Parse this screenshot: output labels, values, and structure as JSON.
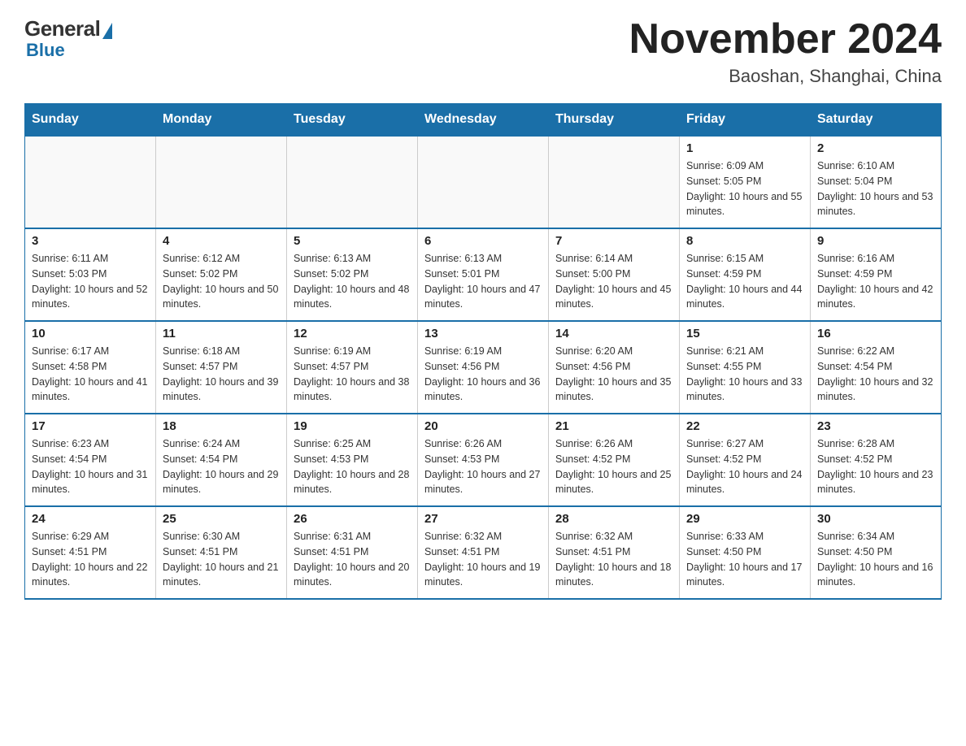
{
  "logo": {
    "general": "General",
    "blue": "Blue"
  },
  "title": {
    "month": "November 2024",
    "location": "Baoshan, Shanghai, China"
  },
  "weekdays": [
    "Sunday",
    "Monday",
    "Tuesday",
    "Wednesday",
    "Thursday",
    "Friday",
    "Saturday"
  ],
  "weeks": [
    [
      {
        "day": "",
        "info": ""
      },
      {
        "day": "",
        "info": ""
      },
      {
        "day": "",
        "info": ""
      },
      {
        "day": "",
        "info": ""
      },
      {
        "day": "",
        "info": ""
      },
      {
        "day": "1",
        "info": "Sunrise: 6:09 AM\nSunset: 5:05 PM\nDaylight: 10 hours and 55 minutes."
      },
      {
        "day": "2",
        "info": "Sunrise: 6:10 AM\nSunset: 5:04 PM\nDaylight: 10 hours and 53 minutes."
      }
    ],
    [
      {
        "day": "3",
        "info": "Sunrise: 6:11 AM\nSunset: 5:03 PM\nDaylight: 10 hours and 52 minutes."
      },
      {
        "day": "4",
        "info": "Sunrise: 6:12 AM\nSunset: 5:02 PM\nDaylight: 10 hours and 50 minutes."
      },
      {
        "day": "5",
        "info": "Sunrise: 6:13 AM\nSunset: 5:02 PM\nDaylight: 10 hours and 48 minutes."
      },
      {
        "day": "6",
        "info": "Sunrise: 6:13 AM\nSunset: 5:01 PM\nDaylight: 10 hours and 47 minutes."
      },
      {
        "day": "7",
        "info": "Sunrise: 6:14 AM\nSunset: 5:00 PM\nDaylight: 10 hours and 45 minutes."
      },
      {
        "day": "8",
        "info": "Sunrise: 6:15 AM\nSunset: 4:59 PM\nDaylight: 10 hours and 44 minutes."
      },
      {
        "day": "9",
        "info": "Sunrise: 6:16 AM\nSunset: 4:59 PM\nDaylight: 10 hours and 42 minutes."
      }
    ],
    [
      {
        "day": "10",
        "info": "Sunrise: 6:17 AM\nSunset: 4:58 PM\nDaylight: 10 hours and 41 minutes."
      },
      {
        "day": "11",
        "info": "Sunrise: 6:18 AM\nSunset: 4:57 PM\nDaylight: 10 hours and 39 minutes."
      },
      {
        "day": "12",
        "info": "Sunrise: 6:19 AM\nSunset: 4:57 PM\nDaylight: 10 hours and 38 minutes."
      },
      {
        "day": "13",
        "info": "Sunrise: 6:19 AM\nSunset: 4:56 PM\nDaylight: 10 hours and 36 minutes."
      },
      {
        "day": "14",
        "info": "Sunrise: 6:20 AM\nSunset: 4:56 PM\nDaylight: 10 hours and 35 minutes."
      },
      {
        "day": "15",
        "info": "Sunrise: 6:21 AM\nSunset: 4:55 PM\nDaylight: 10 hours and 33 minutes."
      },
      {
        "day": "16",
        "info": "Sunrise: 6:22 AM\nSunset: 4:54 PM\nDaylight: 10 hours and 32 minutes."
      }
    ],
    [
      {
        "day": "17",
        "info": "Sunrise: 6:23 AM\nSunset: 4:54 PM\nDaylight: 10 hours and 31 minutes."
      },
      {
        "day": "18",
        "info": "Sunrise: 6:24 AM\nSunset: 4:54 PM\nDaylight: 10 hours and 29 minutes."
      },
      {
        "day": "19",
        "info": "Sunrise: 6:25 AM\nSunset: 4:53 PM\nDaylight: 10 hours and 28 minutes."
      },
      {
        "day": "20",
        "info": "Sunrise: 6:26 AM\nSunset: 4:53 PM\nDaylight: 10 hours and 27 minutes."
      },
      {
        "day": "21",
        "info": "Sunrise: 6:26 AM\nSunset: 4:52 PM\nDaylight: 10 hours and 25 minutes."
      },
      {
        "day": "22",
        "info": "Sunrise: 6:27 AM\nSunset: 4:52 PM\nDaylight: 10 hours and 24 minutes."
      },
      {
        "day": "23",
        "info": "Sunrise: 6:28 AM\nSunset: 4:52 PM\nDaylight: 10 hours and 23 minutes."
      }
    ],
    [
      {
        "day": "24",
        "info": "Sunrise: 6:29 AM\nSunset: 4:51 PM\nDaylight: 10 hours and 22 minutes."
      },
      {
        "day": "25",
        "info": "Sunrise: 6:30 AM\nSunset: 4:51 PM\nDaylight: 10 hours and 21 minutes."
      },
      {
        "day": "26",
        "info": "Sunrise: 6:31 AM\nSunset: 4:51 PM\nDaylight: 10 hours and 20 minutes."
      },
      {
        "day": "27",
        "info": "Sunrise: 6:32 AM\nSunset: 4:51 PM\nDaylight: 10 hours and 19 minutes."
      },
      {
        "day": "28",
        "info": "Sunrise: 6:32 AM\nSunset: 4:51 PM\nDaylight: 10 hours and 18 minutes."
      },
      {
        "day": "29",
        "info": "Sunrise: 6:33 AM\nSunset: 4:50 PM\nDaylight: 10 hours and 17 minutes."
      },
      {
        "day": "30",
        "info": "Sunrise: 6:34 AM\nSunset: 4:50 PM\nDaylight: 10 hours and 16 minutes."
      }
    ]
  ]
}
